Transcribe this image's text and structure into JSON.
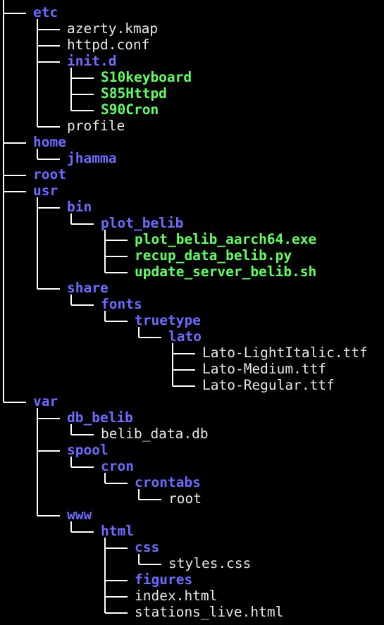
{
  "colors": {
    "background": "#000000",
    "directory": "#6b6bff",
    "executable": "#5fff5f",
    "file": "#e6e6e6",
    "tree_lines": "#ffffff"
  },
  "tree": [
    {
      "name": "etc",
      "kind": "dir",
      "depth": 0,
      "last": false
    },
    {
      "name": "azerty.kmap",
      "kind": "file",
      "depth": 1,
      "last": false
    },
    {
      "name": "httpd.conf",
      "kind": "file",
      "depth": 1,
      "last": false
    },
    {
      "name": "init.d",
      "kind": "dir",
      "depth": 1,
      "last": false
    },
    {
      "name": "S10keyboard",
      "kind": "exec",
      "depth": 2,
      "last": false
    },
    {
      "name": "S85Httpd",
      "kind": "exec",
      "depth": 2,
      "last": false
    },
    {
      "name": "S90Cron",
      "kind": "exec",
      "depth": 2,
      "last": true
    },
    {
      "name": "profile",
      "kind": "file",
      "depth": 1,
      "last": true
    },
    {
      "name": "home",
      "kind": "dir",
      "depth": 0,
      "last": false
    },
    {
      "name": "jhamma",
      "kind": "dir",
      "depth": 1,
      "last": true
    },
    {
      "name": "root",
      "kind": "dir",
      "depth": 0,
      "last": false
    },
    {
      "name": "usr",
      "kind": "dir",
      "depth": 0,
      "last": false
    },
    {
      "name": "bin",
      "kind": "dir",
      "depth": 1,
      "last": false
    },
    {
      "name": "plot_belib",
      "kind": "dir",
      "depth": 2,
      "last": true
    },
    {
      "name": "plot_belib_aarch64.exe",
      "kind": "exec",
      "depth": 3,
      "last": false
    },
    {
      "name": "recup_data_belib.py",
      "kind": "exec",
      "depth": 3,
      "last": false
    },
    {
      "name": "update_server_belib.sh",
      "kind": "exec",
      "depth": 3,
      "last": true
    },
    {
      "name": "share",
      "kind": "dir",
      "depth": 1,
      "last": true
    },
    {
      "name": "fonts",
      "kind": "dir",
      "depth": 2,
      "last": true
    },
    {
      "name": "truetype",
      "kind": "dir",
      "depth": 3,
      "last": true
    },
    {
      "name": "lato",
      "kind": "dir",
      "depth": 4,
      "last": true
    },
    {
      "name": "Lato-LightItalic.ttf",
      "kind": "file",
      "depth": 5,
      "last": false
    },
    {
      "name": "Lato-Medium.ttf",
      "kind": "file",
      "depth": 5,
      "last": false
    },
    {
      "name": "Lato-Regular.ttf",
      "kind": "file",
      "depth": 5,
      "last": true
    },
    {
      "name": "var",
      "kind": "dir",
      "depth": 0,
      "last": true
    },
    {
      "name": "db_belib",
      "kind": "dir",
      "depth": 1,
      "last": false
    },
    {
      "name": "belib_data.db",
      "kind": "file",
      "depth": 2,
      "last": true
    },
    {
      "name": "spool",
      "kind": "dir",
      "depth": 1,
      "last": false
    },
    {
      "name": "cron",
      "kind": "dir",
      "depth": 2,
      "last": true
    },
    {
      "name": "crontabs",
      "kind": "dir",
      "depth": 3,
      "last": true
    },
    {
      "name": "root",
      "kind": "file",
      "depth": 4,
      "last": true
    },
    {
      "name": "www",
      "kind": "dir",
      "depth": 1,
      "last": true
    },
    {
      "name": "html",
      "kind": "dir",
      "depth": 2,
      "last": true
    },
    {
      "name": "css",
      "kind": "dir",
      "depth": 3,
      "last": false
    },
    {
      "name": "styles.css",
      "kind": "file",
      "depth": 4,
      "last": true
    },
    {
      "name": "figures",
      "kind": "dir",
      "depth": 3,
      "last": false
    },
    {
      "name": "index.html",
      "kind": "file",
      "depth": 3,
      "last": false
    },
    {
      "name": "stations_live.html",
      "kind": "file",
      "depth": 3,
      "last": true
    }
  ]
}
